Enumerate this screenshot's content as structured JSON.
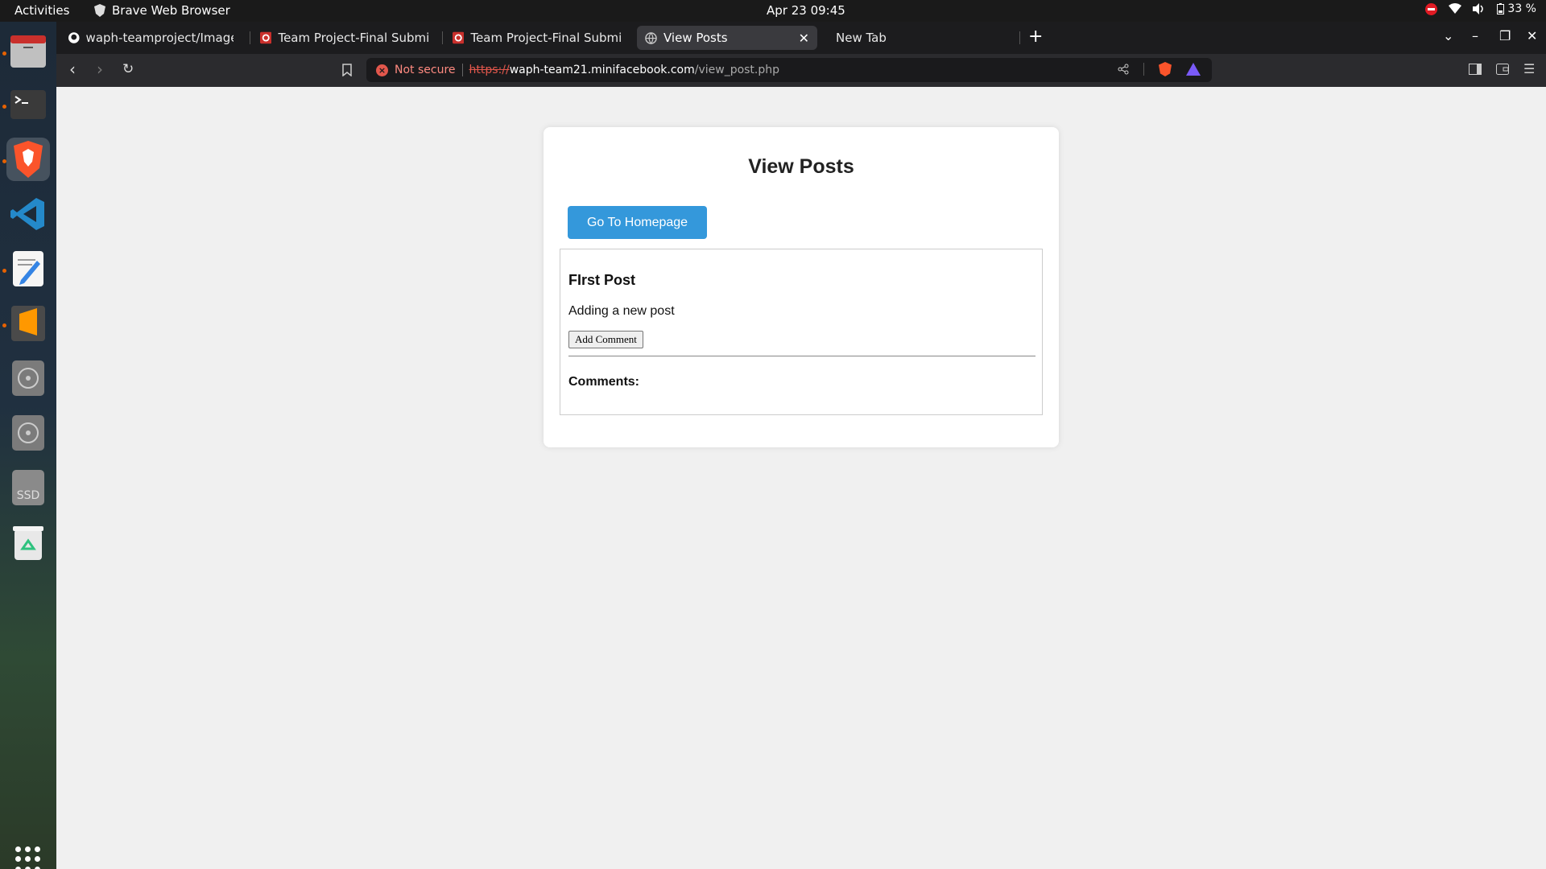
{
  "topbar": {
    "activities": "Activities",
    "app_name": "Brave Web Browser",
    "clock": "Apr 23  09:45",
    "battery": "33 %"
  },
  "dock": {
    "items": [
      {
        "name": "files",
        "icon": "folder-icon"
      },
      {
        "name": "terminal",
        "icon": "terminal-icon"
      },
      {
        "name": "brave",
        "icon": "brave-icon"
      },
      {
        "name": "vscode",
        "icon": "vscode-icon"
      },
      {
        "name": "text-editor",
        "icon": "text-editor-icon"
      },
      {
        "name": "sublime-text",
        "icon": "sublime-icon"
      },
      {
        "name": "disc-1",
        "icon": "disc-icon"
      },
      {
        "name": "disc-2",
        "icon": "disc-icon"
      },
      {
        "name": "ssd",
        "icon": "drive-icon",
        "label": "SSD"
      },
      {
        "name": "trash",
        "icon": "trash-icon"
      }
    ]
  },
  "tabs": [
    {
      "title": "waph-teamproject/Images at",
      "icon": "github-icon"
    },
    {
      "title": "Team Project-Final Submissi",
      "icon": "canvas-icon"
    },
    {
      "title": "Team Project-Final Submissi",
      "icon": "canvas-icon"
    },
    {
      "title": "View Posts",
      "icon": "globe-icon",
      "active": true
    },
    {
      "title": "New Tab"
    }
  ],
  "urlbar": {
    "security_label": "Not secure",
    "scheme": "https://",
    "host": "waph-team21.minifacebook.com",
    "path": "/view_post.php"
  },
  "page": {
    "title": "View Posts",
    "home_button": "Go To Homepage",
    "post": {
      "title": "FIrst Post",
      "body": "Adding a new post",
      "add_comment_button": "Add Comment",
      "comments_label": "Comments:"
    }
  },
  "colors": {
    "accent_button": "#3498db",
    "page_background": "#f0f0f0",
    "insecure": "#e2574c"
  }
}
